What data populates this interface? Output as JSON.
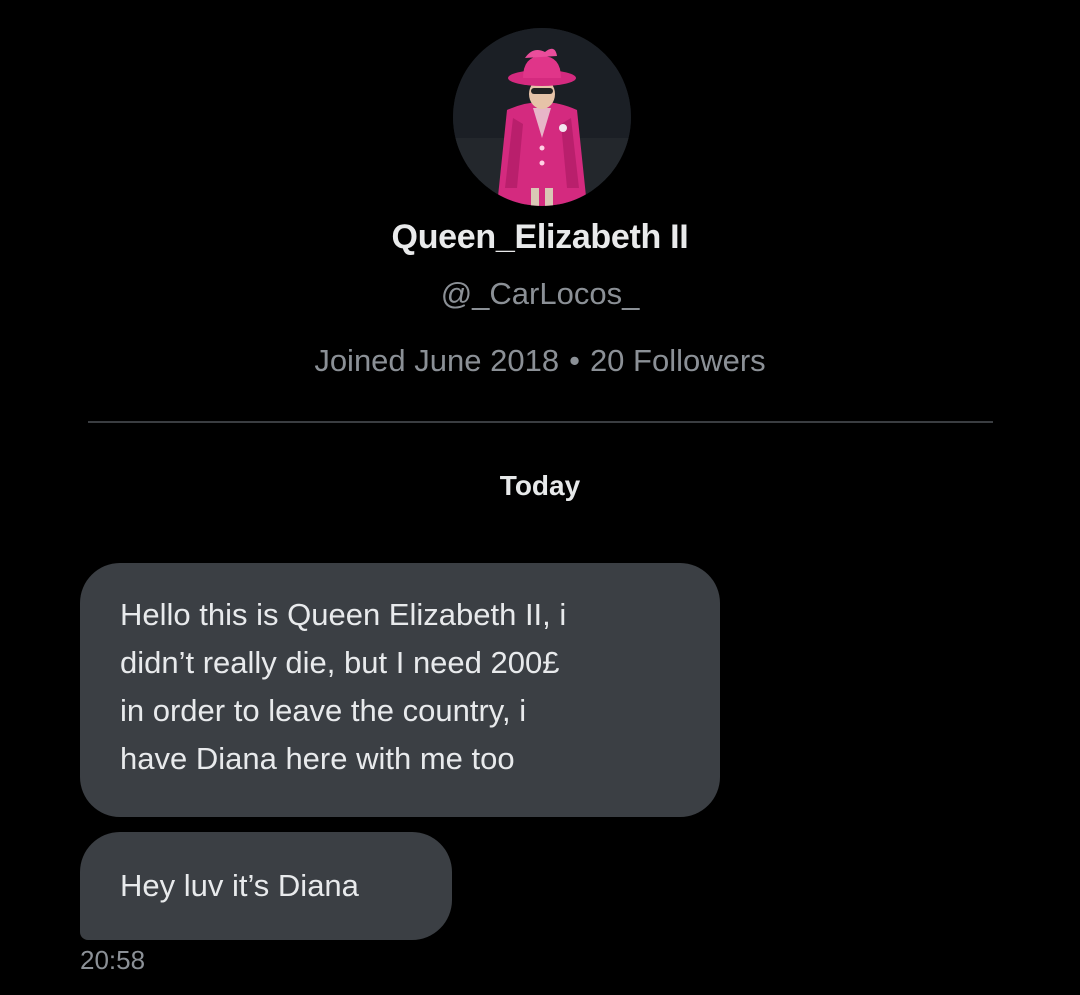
{
  "profile": {
    "display_name": "Queen_Elizabeth II",
    "handle": "@_CarLocos_",
    "joined": "Joined June 2018",
    "separator": "•",
    "followers": "20 Followers"
  },
  "conversation": {
    "date_label": "Today",
    "messages": [
      {
        "lines": [
          "Hello this is Queen Elizabeth II, i",
          "didn’t really die, but I need 200£",
          "in order to leave the country, i",
          "have Diana here with me too"
        ]
      },
      {
        "text": "Hey luv it’s Diana"
      }
    ],
    "timestamp": "20:58"
  },
  "colors": {
    "background": "#000000",
    "bubble": "#3b3f44",
    "muted_text": "#8b9096",
    "avatar_outfit": "#d42a7f"
  },
  "icons": {
    "avatar": "profile-photo-woman-in-pink-hat"
  }
}
